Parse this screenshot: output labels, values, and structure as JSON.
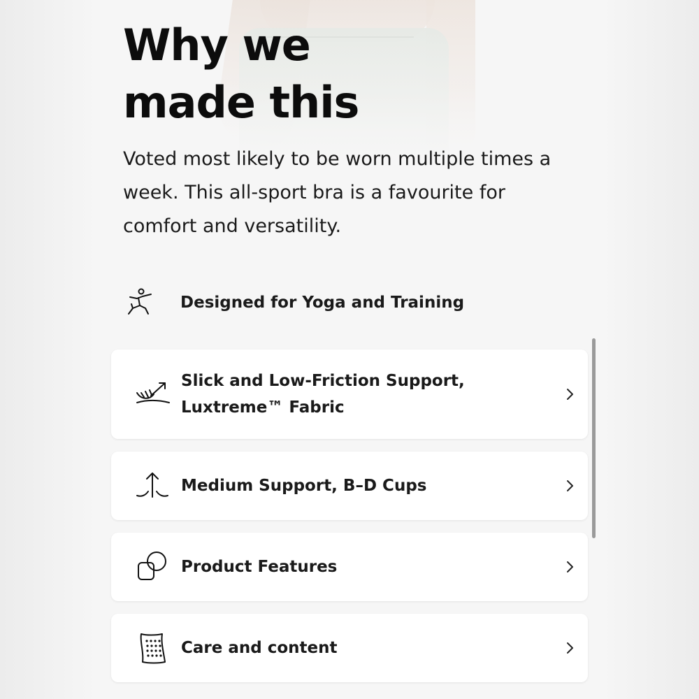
{
  "section": {
    "title_line1": "Why we",
    "title_line2": "made this",
    "description": "Voted most likely to be worn multiple times a week. This all-sport bra is a favourite for comfort and versatility."
  },
  "activity": {
    "icon": "yoga-pose-icon",
    "label": "Designed for Yoga and Training"
  },
  "cards": [
    {
      "icon": "fabric-stretch-icon",
      "label": "Slick and Low-Friction Support, Luxtreme™ Fabric"
    },
    {
      "icon": "support-level-icon",
      "label": "Medium Support, B–D Cups"
    },
    {
      "icon": "features-icon",
      "label": "Product Features"
    },
    {
      "icon": "care-label-icon",
      "label": "Care and content"
    }
  ],
  "colors": {
    "background": "#f6f6f6",
    "card": "#ffffff",
    "text": "#111111"
  }
}
